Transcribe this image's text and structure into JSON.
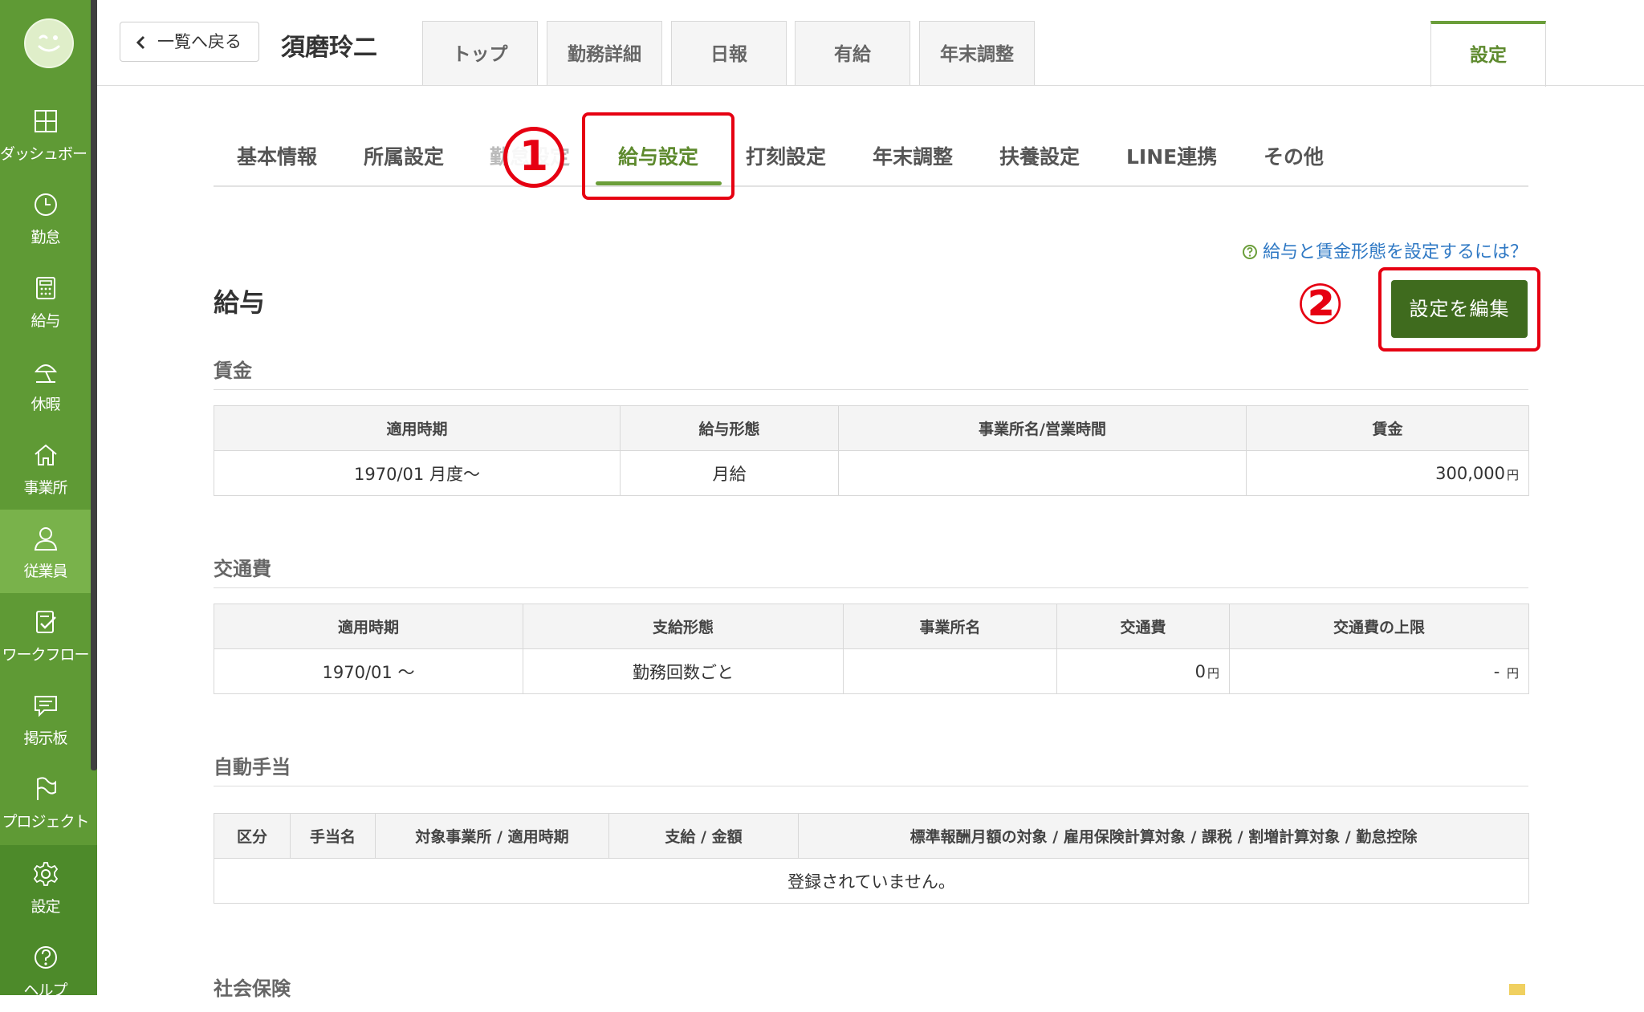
{
  "sidebar": {
    "items": [
      {
        "label": "ダッシュボード",
        "icon": "dashboard-icon"
      },
      {
        "label": "勤怠",
        "icon": "clock-icon"
      },
      {
        "label": "給与",
        "icon": "calculator-icon"
      },
      {
        "label": "休暇",
        "icon": "beach-umbrella-icon"
      },
      {
        "label": "事業所",
        "icon": "home-icon"
      },
      {
        "label": "従業員",
        "icon": "user-icon"
      },
      {
        "label": "ワークフロー",
        "icon": "workflow-icon"
      },
      {
        "label": "掲示板",
        "icon": "message-board-icon"
      },
      {
        "label": "プロジェクト",
        "icon": "flag-icon"
      },
      {
        "label": "設定",
        "icon": "gear-icon"
      },
      {
        "label": "ヘルプ",
        "icon": "help-icon"
      }
    ],
    "active_index": 5
  },
  "header": {
    "back_label": "一覧へ戻る",
    "employee_name": "須磨玲二",
    "tabs": [
      {
        "label": "トップ"
      },
      {
        "label": "勤務詳細"
      },
      {
        "label": "日報"
      },
      {
        "label": "有給"
      },
      {
        "label": "年末調整"
      }
    ],
    "settings_tab": "設定"
  },
  "sub_tabs": {
    "items": [
      {
        "label": "基本情報"
      },
      {
        "label": "所属設定"
      },
      {
        "label": "勤怠設定"
      },
      {
        "label": "給与設定"
      },
      {
        "label": "打刻設定"
      },
      {
        "label": "年末調整"
      },
      {
        "label": "扶養設定"
      },
      {
        "label": "LINE連携"
      },
      {
        "label": "その他"
      }
    ],
    "active_index": 3
  },
  "annotations": {
    "step1": "1",
    "step2": "②"
  },
  "main": {
    "help_link": "給与と賃金形態を設定するには？",
    "section_title": "給与",
    "edit_button": "設定を編集",
    "wage": {
      "title": "賃金",
      "headers": [
        "適用時期",
        "給与形態",
        "事業所名/営業時間",
        "賃金"
      ],
      "rows": [
        {
          "period": "1970/01 月度〜",
          "type": "月給",
          "office": "",
          "amount": "300,000",
          "unit": "円"
        }
      ]
    },
    "commute": {
      "title": "交通費",
      "headers": [
        "適用時期",
        "支給形態",
        "事業所名",
        "交通費",
        "交通費の上限"
      ],
      "rows": [
        {
          "period": "1970/01 〜",
          "type": "勤務回数ごと",
          "office": "",
          "amount": "0",
          "unit": "円",
          "limit": "- ",
          "limit_unit": "円"
        }
      ]
    },
    "allowance": {
      "title": "自動手当",
      "headers": [
        "区分",
        "手当名",
        "対象事業所 / 適用時期",
        "支給 / 金額",
        "標準報酬月額の対象 / 雇用保険計算対象 / 課税 / 割増計算対象 / 勤怠控除"
      ],
      "empty_message": "登録されていません。"
    },
    "social_insurance_title": "社会保険"
  }
}
